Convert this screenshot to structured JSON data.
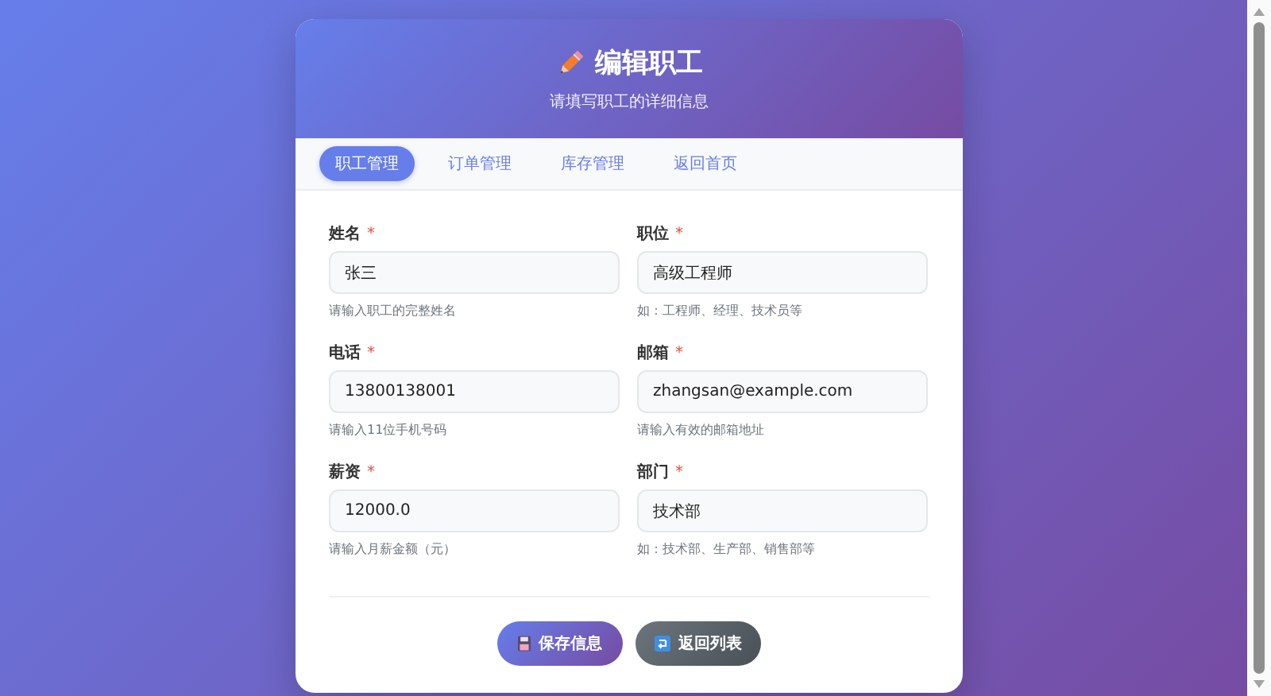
{
  "header": {
    "title": "编辑职工",
    "subtitle": "请填写职工的详细信息"
  },
  "tabs": [
    {
      "label": "职工管理",
      "selected": true
    },
    {
      "label": "订单管理",
      "selected": false
    },
    {
      "label": "库存管理",
      "selected": false
    },
    {
      "label": "返回首页",
      "selected": false
    }
  ],
  "fields": [
    {
      "label": "姓名",
      "required_mark": "*",
      "value": "张三",
      "hint": "请输入职工的完整姓名"
    },
    {
      "label": "职位",
      "required_mark": "*",
      "value": "高级工程师",
      "hint": "如：工程师、经理、技术员等"
    },
    {
      "label": "电话",
      "required_mark": "*",
      "value": "13800138001",
      "hint": "请输入11位手机号码"
    },
    {
      "label": "邮箱",
      "required_mark": "*",
      "value": "zhangsan@example.com",
      "hint": "请输入有效的邮箱地址"
    },
    {
      "label": "薪资",
      "required_mark": "*",
      "value": "12000.0",
      "hint": "请输入月薪金额（元）"
    },
    {
      "label": "部门",
      "required_mark": "*",
      "value": "技术部",
      "hint": "如：技术部、生产部、销售部等"
    }
  ],
  "buttons": [
    {
      "kind": "save",
      "label": "保存信息"
    },
    {
      "kind": "back",
      "label": "返回列表"
    }
  ]
}
